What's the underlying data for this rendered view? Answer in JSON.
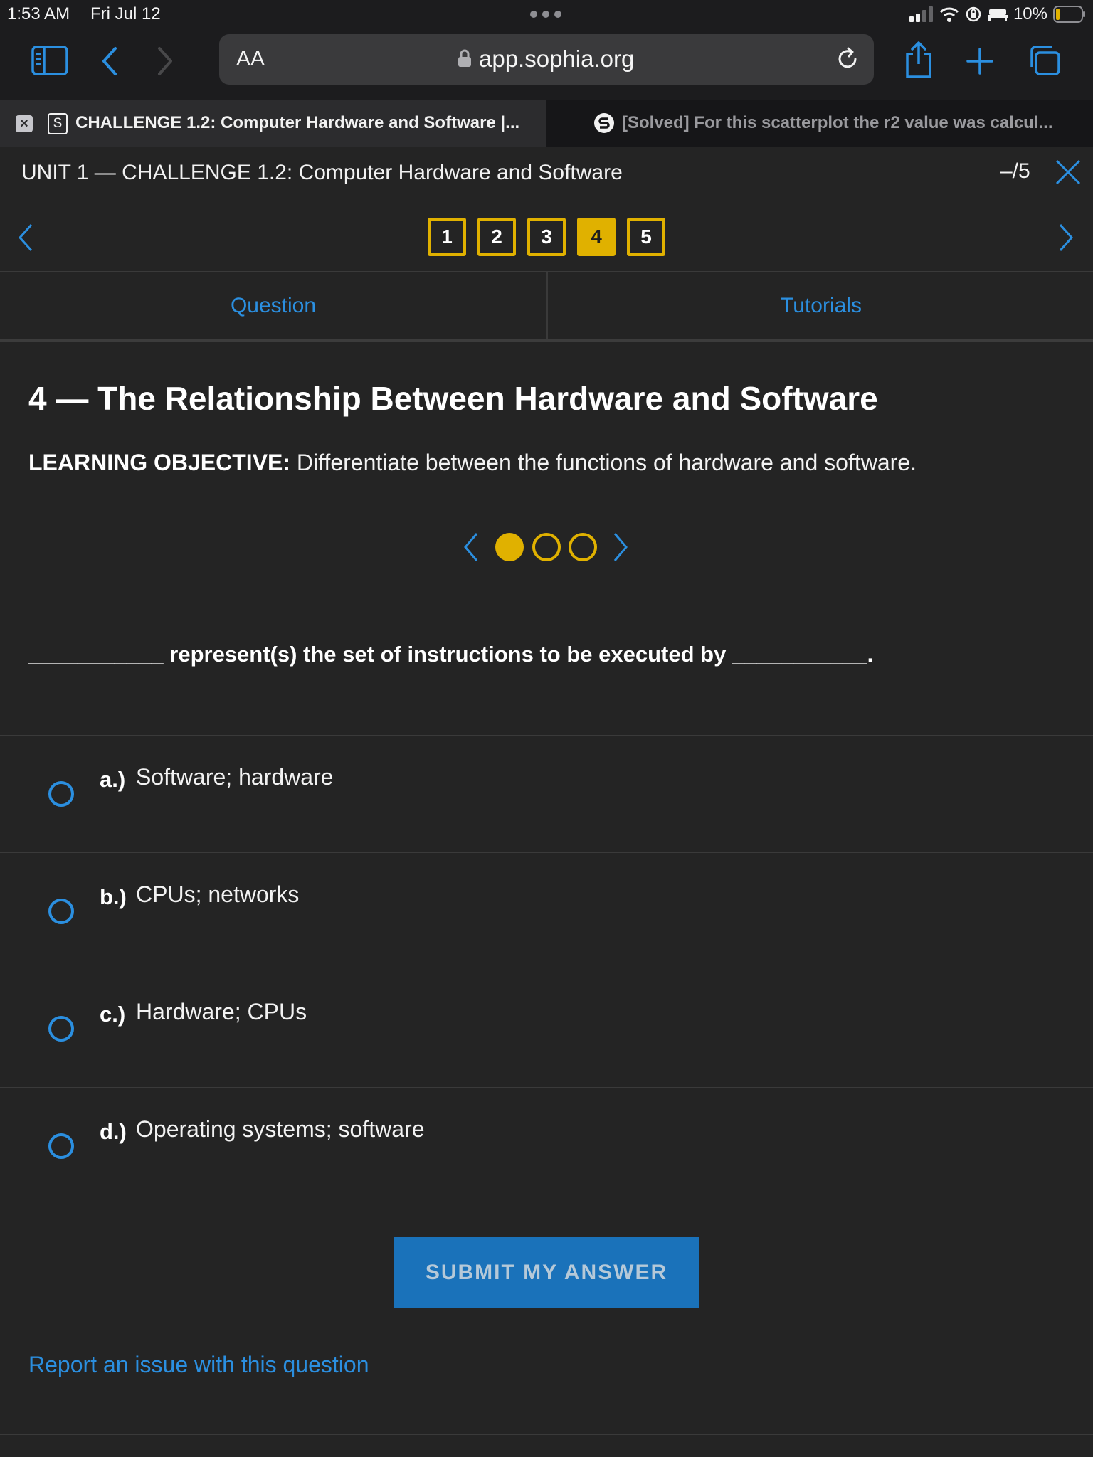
{
  "status_bar": {
    "time": "1:53 AM",
    "date": "Fri Jul 12",
    "battery": "10%"
  },
  "browser": {
    "text_size_label": "AA",
    "url": "app.sophia.org",
    "tabs": [
      {
        "favicon": "S",
        "title": "CHALLENGE 1.2: Computer Hardware and Software |...",
        "active": true
      },
      {
        "title": "[Solved] For this scatterplot the r2 value was calcul...",
        "active": false
      }
    ]
  },
  "unit": {
    "title": "UNIT 1 — CHALLENGE 1.2: Computer Hardware and Software",
    "score": "–/5"
  },
  "question_nav": {
    "numbers": [
      "1",
      "2",
      "3",
      "4",
      "5"
    ],
    "active_index": 3
  },
  "tabs": {
    "question": "Question",
    "tutorials": "Tutorials"
  },
  "content": {
    "title": "4 — The Relationship Between Hardware and Software",
    "objective_label": "LEARNING OBJECTIVE:",
    "objective_text": " Differentiate between the functions of hardware and software.",
    "carousel_active": 0,
    "question": "___________ represent(s) the set of instructions to be executed by ___________.",
    "answers": [
      {
        "letter": "a.)",
        "text": "Software; hardware"
      },
      {
        "letter": "b.)",
        "text": "CPUs; networks"
      },
      {
        "letter": "c.)",
        "text": "Hardware; CPUs"
      },
      {
        "letter": "d.)",
        "text": "Operating systems; software"
      }
    ],
    "submit_label": "SUBMIT MY ANSWER",
    "report_label": "Report an issue with this question"
  },
  "colors": {
    "accent_blue": "#2b8fe0",
    "accent_yellow": "#e0b100",
    "background": "#242424",
    "submit_bg": "#1a72ba"
  }
}
